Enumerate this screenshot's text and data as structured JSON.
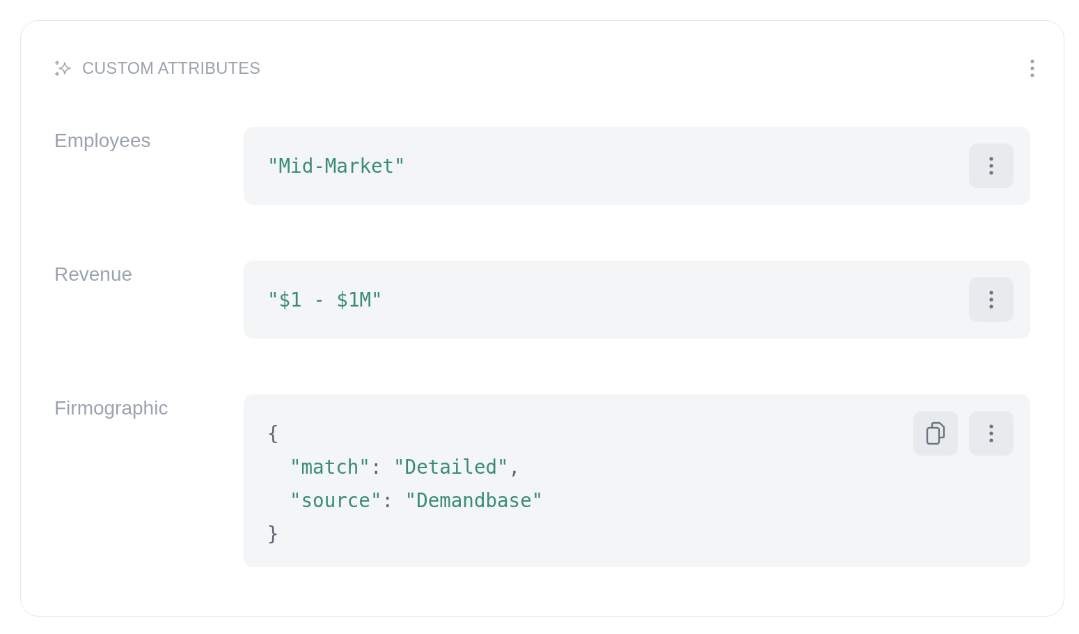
{
  "header": {
    "title": "CUSTOM ATTRIBUTES"
  },
  "attributes": [
    {
      "label": "Employees",
      "kind": "string",
      "value": "\"Mid-Market\"",
      "copyable": false
    },
    {
      "label": "Revenue",
      "kind": "string",
      "value": "\"$1 - $1M\"",
      "copyable": false
    },
    {
      "label": "Firmographic",
      "kind": "object",
      "copyable": true,
      "open": "{",
      "close": "}",
      "entries": [
        {
          "key": "\"match\"",
          "sep": ":",
          "value": "\"Detailed\"",
          "comma": ","
        },
        {
          "key": "\"source\"",
          "sep": ":",
          "value": "\"Demandbase\""
        }
      ]
    }
  ]
}
